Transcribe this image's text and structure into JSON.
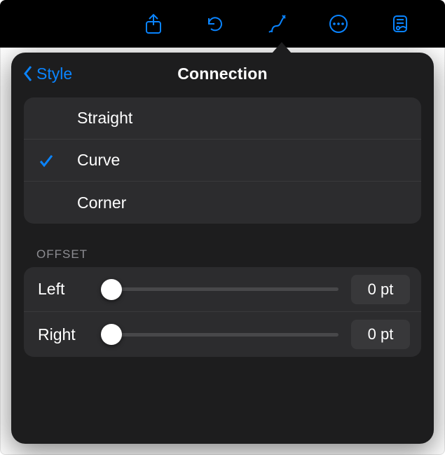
{
  "toolbar": {
    "icons": [
      "share-icon",
      "undo-icon",
      "format-icon",
      "more-icon",
      "presenter-icon"
    ],
    "active": "format-icon"
  },
  "popover": {
    "back_label": "Style",
    "title": "Connection"
  },
  "connection_options": [
    {
      "label": "Straight",
      "selected": false
    },
    {
      "label": "Curve",
      "selected": true
    },
    {
      "label": "Corner",
      "selected": false
    }
  ],
  "offset": {
    "header": "OFFSET",
    "rows": [
      {
        "label": "Left",
        "value": "0 pt",
        "pct": 0
      },
      {
        "label": "Right",
        "value": "0 pt",
        "pct": 0
      }
    ]
  }
}
